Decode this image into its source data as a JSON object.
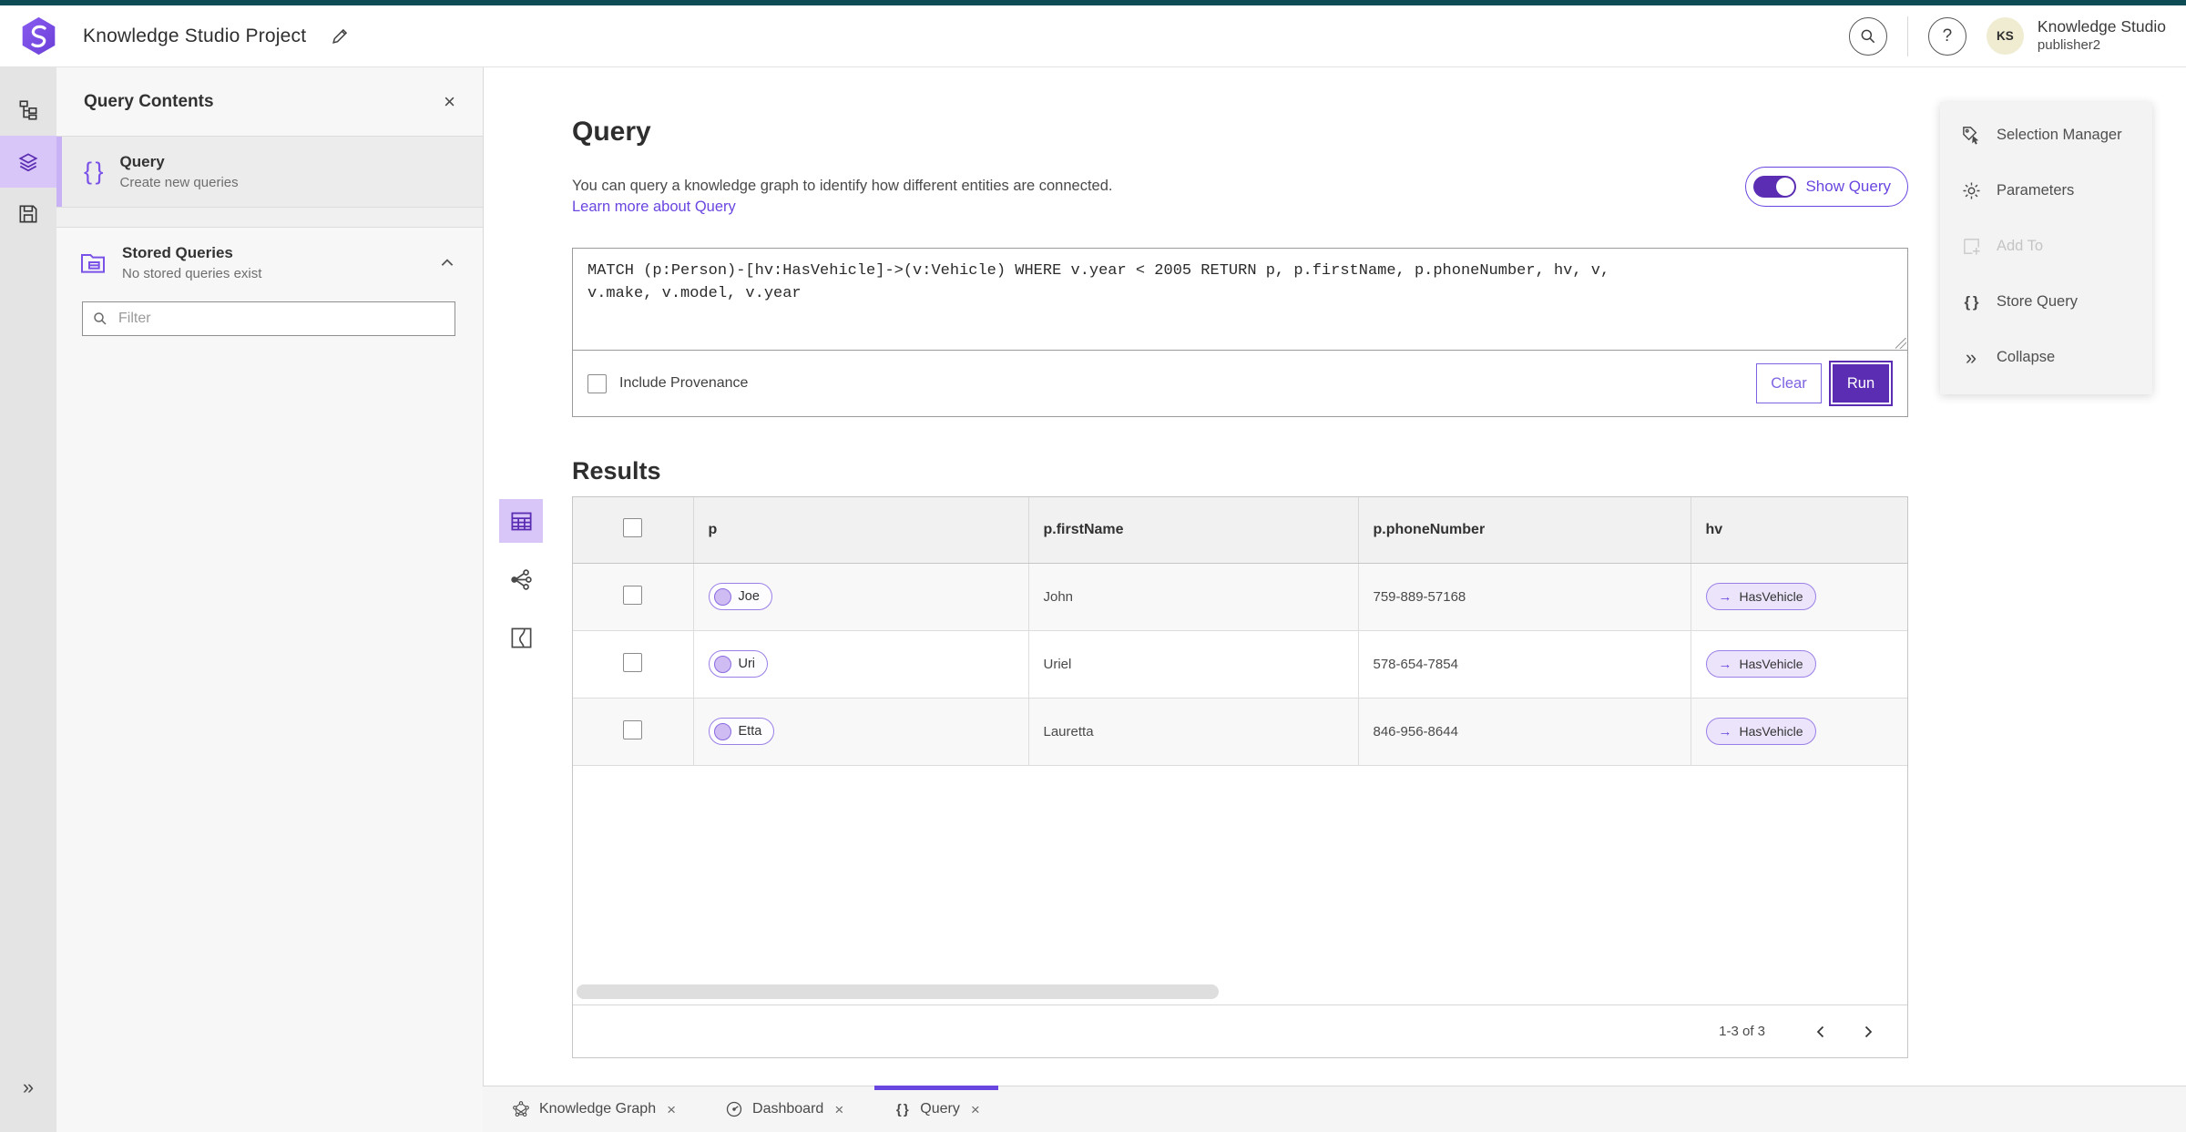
{
  "colors": {
    "teal": "#0d4c55",
    "accent": "#6a46e0",
    "accent-dark": "#5b2db3",
    "accent-light": "#d9c6f8",
    "pill-bg": "#ece4fb"
  },
  "icons": {
    "question": "?",
    "close": "×",
    "collapse": "»",
    "braces": "{ }",
    "arrow": "→"
  },
  "header": {
    "app_title": "Knowledge Studio Project",
    "user_name": "Knowledge Studio",
    "user_role": "publisher2",
    "avatar_initials": "KS"
  },
  "contents_panel": {
    "title": "Query Contents",
    "query_item": {
      "title": "Query",
      "subtitle": "Create new queries"
    },
    "stored_queries": {
      "title": "Stored Queries",
      "subtitle": "No stored queries exist"
    },
    "filter_placeholder": "Filter"
  },
  "query_section": {
    "title": "Query",
    "description": "You can query a knowledge graph to identify how different entities are connected.",
    "learn_more_label": "Learn more about Query",
    "show_query_label": "Show Query",
    "query_text": "MATCH (p:Person)-[hv:HasVehicle]->(v:Vehicle) WHERE v.year < 2005 RETURN p, p.firstName, p.phoneNumber, hv, v,\nv.make, v.model, v.year",
    "include_provenance_label": "Include Provenance",
    "clear_label": "Clear",
    "run_label": "Run"
  },
  "results": {
    "title": "Results",
    "columns": [
      "p",
      "p.firstName",
      "p.phoneNumber",
      "hv"
    ],
    "rows": [
      {
        "p": "Joe",
        "firstName": "John",
        "phone": "759-889-57168",
        "hv": "HasVehicle"
      },
      {
        "p": "Uri",
        "firstName": "Uriel",
        "phone": "578-654-7854",
        "hv": "HasVehicle"
      },
      {
        "p": "Etta",
        "firstName": "Lauretta",
        "phone": "846-956-8644",
        "hv": "HasVehicle"
      }
    ],
    "pagination": "1-3 of 3"
  },
  "tools_panel": {
    "items": [
      {
        "label": "Selection Manager"
      },
      {
        "label": "Parameters"
      },
      {
        "label": "Add To"
      },
      {
        "label": "Store Query"
      },
      {
        "label": "Collapse"
      }
    ]
  },
  "bottom_tabs": [
    {
      "label": "Knowledge Graph"
    },
    {
      "label": "Dashboard"
    },
    {
      "label": "Query"
    }
  ]
}
